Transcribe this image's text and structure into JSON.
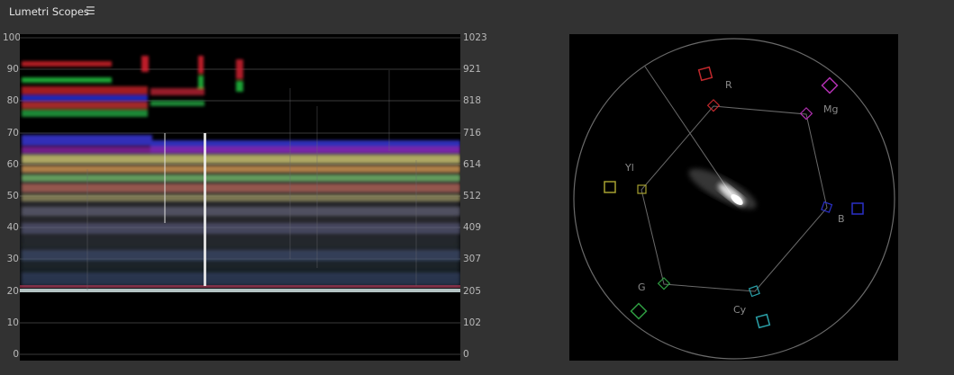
{
  "header": {
    "title": "Lumetri Scopes",
    "menu_icon": "hamburger-menu-icon"
  },
  "waveform": {
    "left_scale": [
      "100",
      "90",
      "80",
      "70",
      "60",
      "50",
      "40",
      "30",
      "20",
      "10",
      "0"
    ],
    "right_scale": [
      "1023",
      "921",
      "818",
      "716",
      "614",
      "512",
      "409",
      "307",
      "205",
      "102",
      "0"
    ]
  },
  "vectorscope": {
    "targets": [
      "R",
      "Mg",
      "B",
      "Cy",
      "G",
      "Yl"
    ],
    "colors": {
      "R": "#c0282c",
      "Mg": "#b030b0",
      "B": "#2a30c8",
      "Cy": "#2aa0a8",
      "G": "#2e9a40",
      "Yl": "#a6a030"
    }
  }
}
